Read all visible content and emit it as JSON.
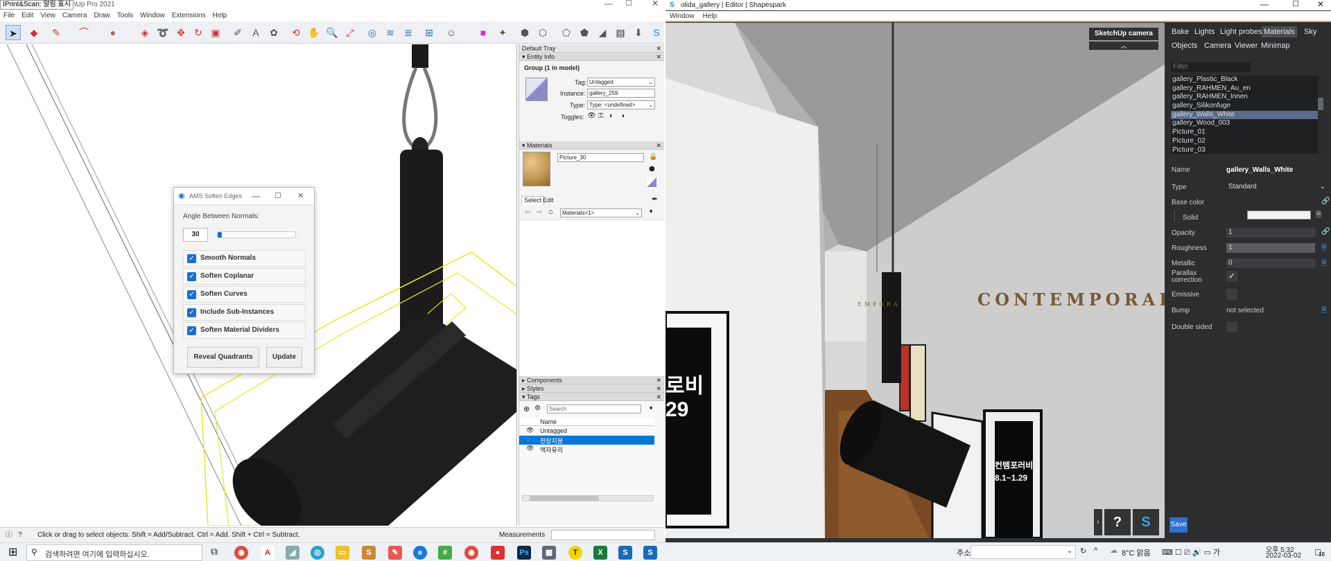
{
  "tooltip": "IPrint&Scan: 알림 표시",
  "sketchup": {
    "title_fragment": "hUp Pro 2021",
    "menu": [
      "File",
      "Edit",
      "View",
      "Camera",
      "Draw",
      "Tools",
      "Window",
      "Extensions",
      "Help"
    ],
    "status_text": "Click or drag to select objects. Shift = Add/Subtract. Ctrl = Add. Shift + Ctrl = Subtract.",
    "measurements_label": "Measurements"
  },
  "dialog": {
    "title": "AMS Soften Edges",
    "angle_label": "Angle Between Normals:",
    "angle_value": "30",
    "slider_fraction": 0.05,
    "options": [
      {
        "label": "Smooth Normals",
        "checked": true
      },
      {
        "label": "Soften Coplanar",
        "checked": true
      },
      {
        "label": "Soften Curves",
        "checked": true
      },
      {
        "label": "Include Sub-Instances",
        "checked": true
      },
      {
        "label": "Soften Material Dividers",
        "checked": true
      }
    ],
    "reveal_button": "Reveal Quadrants",
    "update_button": "Update"
  },
  "tray": {
    "title": "Default Tray",
    "entity_info": {
      "header": "Entity Info",
      "subtitle": "Group (1 in model)",
      "tag_label": "Tag:",
      "tag_value": "Untagged",
      "instance_label": "Instance:",
      "instance_value": "gallery_259",
      "type_label": "Type:",
      "type_value": "Type: <undefined>",
      "toggles_label": "Toggles:"
    },
    "materials": {
      "header": "Materials",
      "name": "Picture_30",
      "tab_select": "Select",
      "tab_edit": "Edit",
      "dropdown": "Materials<1>"
    },
    "components_header": "Components",
    "styles_header": "Styles",
    "tags": {
      "header": "Tags",
      "search_placeholder": "Search",
      "col_name": "Name",
      "rows": [
        {
          "name": "Untagged",
          "selected": false
        },
        {
          "name": "천장지붕",
          "selected": true
        },
        {
          "name": "액자유리",
          "selected": false
        }
      ]
    }
  },
  "shapespark": {
    "title": "olida_gallery | Editor | Shapespark",
    "menu": [
      "Window",
      "Help"
    ],
    "camera_button": "SketchUp camera",
    "wall_text": "CONTEMPORAR",
    "wall_text_small": "EMPORA",
    "poster1_text": "로비\n29",
    "poster2_text": "컨템포러비\n8.1~1.29",
    "help_button": "?",
    "tabs_row1": [
      "Bake",
      "Lights",
      "Light probes",
      "Materials",
      "Sky"
    ],
    "tabs_row2": [
      "Objects",
      "Camera",
      "Viewer",
      "Minimap"
    ],
    "active_tab": "Materials",
    "filter_placeholder": "Filter",
    "material_list": [
      {
        "name": "gallery_Plastic_Black",
        "selected": false
      },
      {
        "name": "gallery_RAHMEN_Au_en",
        "selected": false
      },
      {
        "name": "gallery_RAHMEN_Innen",
        "selected": false
      },
      {
        "name": "gallery_Silikonfuge",
        "selected": false
      },
      {
        "name": "gallery_Walls_White",
        "selected": true
      },
      {
        "name": "gallery_Wood_003",
        "selected": false
      },
      {
        "name": "Picture_01",
        "selected": false
      },
      {
        "name": "Picture_02",
        "selected": false
      },
      {
        "name": "Picture_03",
        "selected": false
      }
    ],
    "props": {
      "name_label": "Name",
      "name_value": "gallery_Walls_White",
      "type_label": "Type",
      "type_value": "Standard",
      "base_color_label": "Base color",
      "solid_label": "Solid",
      "opacity_label": "Opacity",
      "opacity_value": "1",
      "roughness_label": "Roughness",
      "roughness_value": "1",
      "metallic_label": "Metallic",
      "metallic_value": "0",
      "parallax_label_1": "Parallax",
      "parallax_label_2": "correction",
      "emissive_label": "Emissive",
      "bump_label": "Bump",
      "bump_value": "not selected",
      "double_sided_label": "Double sided"
    },
    "save_button": "Save"
  },
  "taskbar": {
    "search_placeholder": "검색하려면 여기에 입력하십시오.",
    "address_label": "주소",
    "weather": "8°C 맑음",
    "time": "오후 5:32",
    "date": "2022-03-02",
    "notification_count": "10"
  }
}
